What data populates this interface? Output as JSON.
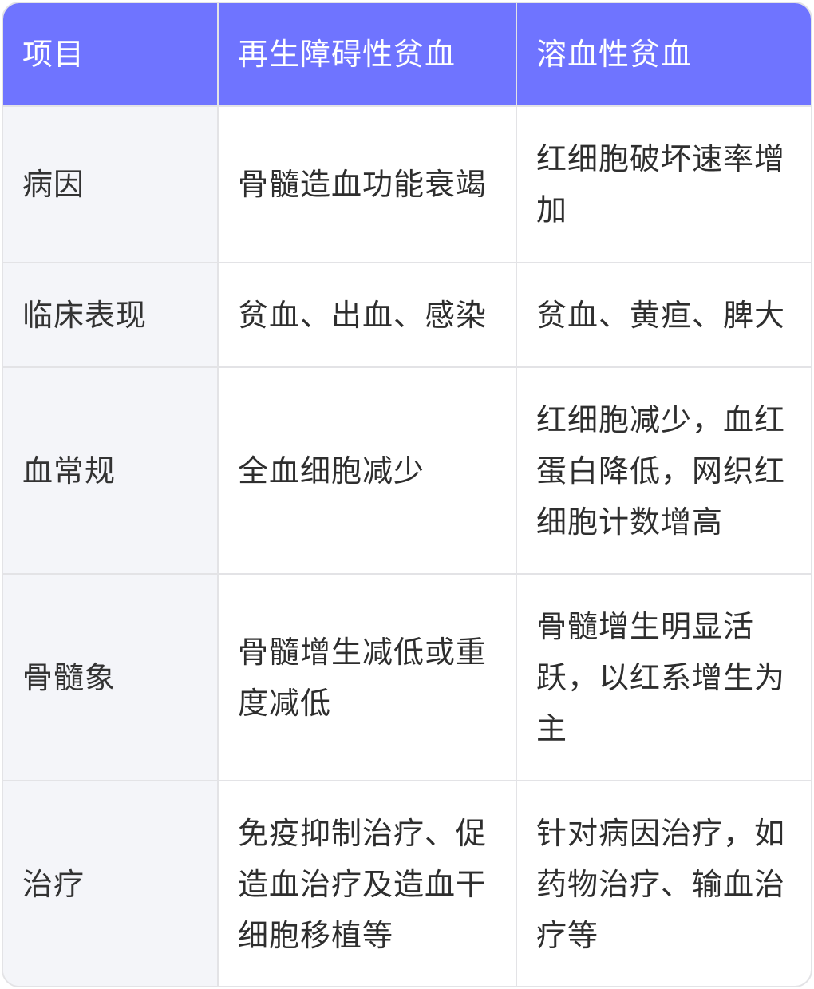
{
  "header": [
    "项目",
    "再生障碍性贫血",
    "溶血性贫血"
  ],
  "rows": [
    [
      "病因",
      "骨髓造血功能衰竭",
      "红细胞破坏速率增加"
    ],
    [
      "临床表现",
      "贫血、出血、感染",
      "贫血、黄疸、脾大"
    ],
    [
      "血常规",
      "全血细胞减少",
      "红细胞减少，血红蛋白降低，网织红细胞计数增高"
    ],
    [
      "骨髓象",
      "骨髓增生减低或重度减低",
      "骨髓增生明显活跃，以红系增生为主"
    ],
    [
      "治疗",
      "免疫抑制治疗、促造血治疗及造血干细胞移植等",
      "针对病因治疗，如药物治疗、输血治疗等"
    ]
  ],
  "colors": {
    "header_bg": "#6f74ff",
    "label_bg": "#f4f5f9",
    "border": "#e3e3e6"
  }
}
